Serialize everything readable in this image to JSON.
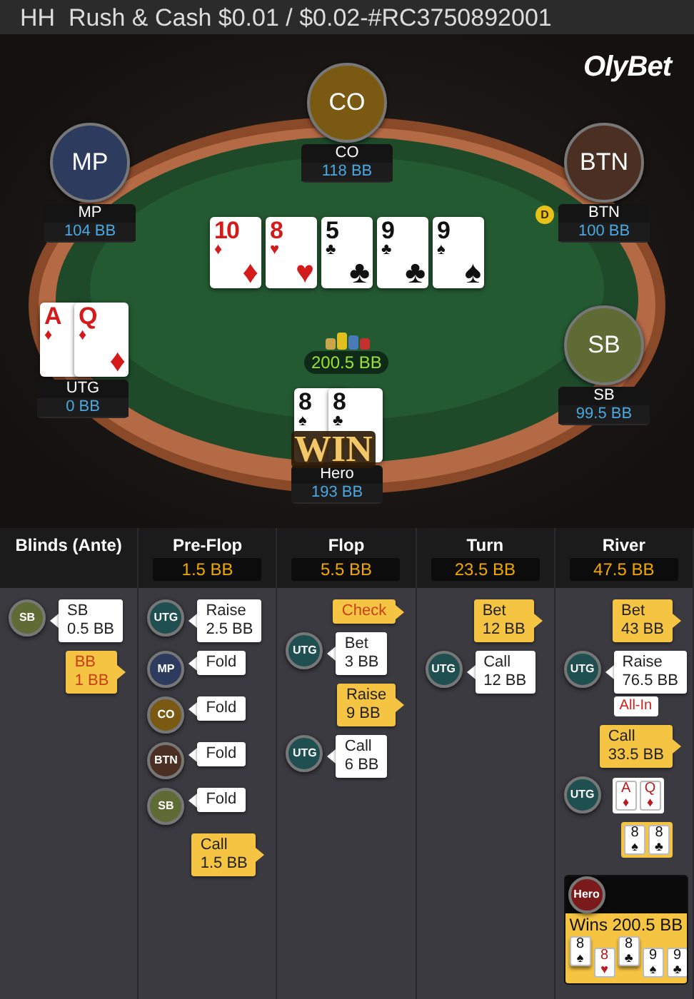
{
  "title": "HH  Rush & Cash $0.01 / $0.02-#RC3750892001",
  "logo": "OlyBet",
  "table": {
    "board": [
      {
        "rank": "10",
        "suit": "♦",
        "red": true
      },
      {
        "rank": "8",
        "suit": "♥",
        "red": true
      },
      {
        "rank": "5",
        "suit": "♣",
        "red": false
      },
      {
        "rank": "9",
        "suit": "♣",
        "red": false
      },
      {
        "rank": "9",
        "suit": "♠",
        "red": false
      }
    ],
    "pot": "200.5 BB",
    "seats": [
      {
        "avatar": "CO",
        "name": "CO",
        "stack": "118 BB",
        "color": "#7a5a12"
      },
      {
        "avatar": "MP",
        "name": "MP",
        "stack": "104 BB",
        "color": "#2d3b5e"
      },
      {
        "avatar": "BTN",
        "name": "BTN",
        "stack": "100 BB",
        "color": "#4a2f22",
        "dealer_chip": "D"
      },
      {
        "name": "UTG",
        "stack": "0 BB",
        "cards": [
          {
            "rank": "A",
            "suit": "♦",
            "red": true
          },
          {
            "rank": "Q",
            "suit": "♦",
            "red": true
          }
        ]
      },
      {
        "avatar": "SB",
        "name": "SB",
        "stack": "99.5 BB",
        "color": "#5e6b34"
      },
      {
        "name": "Hero",
        "stack": "193 BB",
        "cards": [
          {
            "rank": "8",
            "suit": "♠",
            "red": false
          },
          {
            "rank": "8",
            "suit": "♣",
            "red": false
          }
        ],
        "badge": "WIN"
      }
    ]
  },
  "streets": [
    {
      "name": "Blinds (Ante)",
      "actions": [
        {
          "kind": "bet",
          "hero": false,
          "seat": "SB",
          "color": "#5e6b34",
          "lines": [
            "SB",
            "0.5 BB"
          ],
          "highlight": false
        },
        {
          "kind": "bet",
          "hero": true,
          "lines": [
            "BB",
            "1 BB"
          ],
          "highlight": true
        }
      ]
    },
    {
      "name": "Pre-Flop",
      "pot": "1.5 BB",
      "actions": [
        {
          "kind": "bet",
          "hero": false,
          "seat": "UTG",
          "color": "#1f4f50",
          "lines": [
            "Raise",
            "2.5 BB"
          ],
          "highlight": false
        },
        {
          "kind": "bet",
          "hero": false,
          "seat": "MP",
          "color": "#2d3b5e",
          "lines": [
            "Fold"
          ],
          "highlight": false
        },
        {
          "kind": "bet",
          "hero": false,
          "seat": "CO",
          "color": "#7a5a12",
          "lines": [
            "Fold"
          ],
          "highlight": false
        },
        {
          "kind": "bet",
          "hero": false,
          "seat": "BTN",
          "color": "#4a2f22",
          "lines": [
            "Fold"
          ],
          "highlight": false
        },
        {
          "kind": "bet",
          "hero": false,
          "seat": "SB",
          "color": "#5e6b34",
          "lines": [
            "Fold"
          ],
          "highlight": false
        },
        {
          "kind": "bet",
          "hero": true,
          "lines": [
            "Call",
            "1.5 BB"
          ],
          "highlight": false
        }
      ]
    },
    {
      "name": "Flop",
      "pot": "5.5 BB",
      "actions": [
        {
          "kind": "bet",
          "hero": true,
          "lines": [
            "Check"
          ],
          "highlight": true
        },
        {
          "kind": "bet",
          "hero": false,
          "seat": "UTG",
          "color": "#1f4f50",
          "lines": [
            "Bet",
            "3 BB"
          ],
          "highlight": false
        },
        {
          "kind": "bet",
          "hero": true,
          "lines": [
            "Raise",
            "9 BB"
          ],
          "highlight": false
        },
        {
          "kind": "bet",
          "hero": false,
          "seat": "UTG",
          "color": "#1f4f50",
          "lines": [
            "Call",
            "6 BB"
          ],
          "highlight": false
        }
      ]
    },
    {
      "name": "Turn",
      "pot": "23.5 BB",
      "actions": [
        {
          "kind": "bet",
          "hero": true,
          "lines": [
            "Bet",
            "12 BB"
          ],
          "highlight": false
        },
        {
          "kind": "bet",
          "hero": false,
          "seat": "UTG",
          "color": "#1f4f50",
          "lines": [
            "Call",
            "12 BB"
          ],
          "highlight": false
        }
      ]
    },
    {
      "name": "River",
      "pot": "47.5 BB",
      "actions": [
        {
          "kind": "bet",
          "hero": true,
          "lines": [
            "Bet",
            "43 BB"
          ],
          "highlight": false
        },
        {
          "kind": "bet",
          "hero": false,
          "seat": "UTG",
          "color": "#1f4f50",
          "lines": [
            "Raise",
            "76.5 BB"
          ],
          "highlight": false,
          "tag": "All-In"
        },
        {
          "kind": "bet",
          "hero": true,
          "lines": [
            "Call",
            "33.5 BB"
          ],
          "highlight": false
        },
        {
          "kind": "show",
          "hero": false,
          "seat": "UTG",
          "color": "#1f4f50",
          "cards": [
            {
              "rank": "A",
              "suit": "♦",
              "red": true
            },
            {
              "rank": "Q",
              "suit": "♦",
              "red": true
            }
          ]
        },
        {
          "kind": "show",
          "hero": true,
          "cards": [
            {
              "rank": "8",
              "suit": "♠",
              "red": false
            },
            {
              "rank": "8",
              "suit": "♣",
              "red": false
            }
          ]
        },
        {
          "kind": "win",
          "seat": "Hero",
          "color": "#7a1a1a",
          "text": "Wins 200.5 BB",
          "cards": [
            {
              "rank": "8",
              "suit": "♠",
              "red": false,
              "raised": true
            },
            {
              "rank": "8",
              "suit": "♥",
              "red": true,
              "raised": false
            },
            {
              "rank": "8",
              "suit": "♣",
              "red": false,
              "raised": true
            },
            {
              "rank": "9",
              "suit": "♠",
              "red": false,
              "raised": false
            },
            {
              "rank": "9",
              "suit": "♣",
              "red": false,
              "raised": false
            }
          ]
        }
      ]
    }
  ]
}
